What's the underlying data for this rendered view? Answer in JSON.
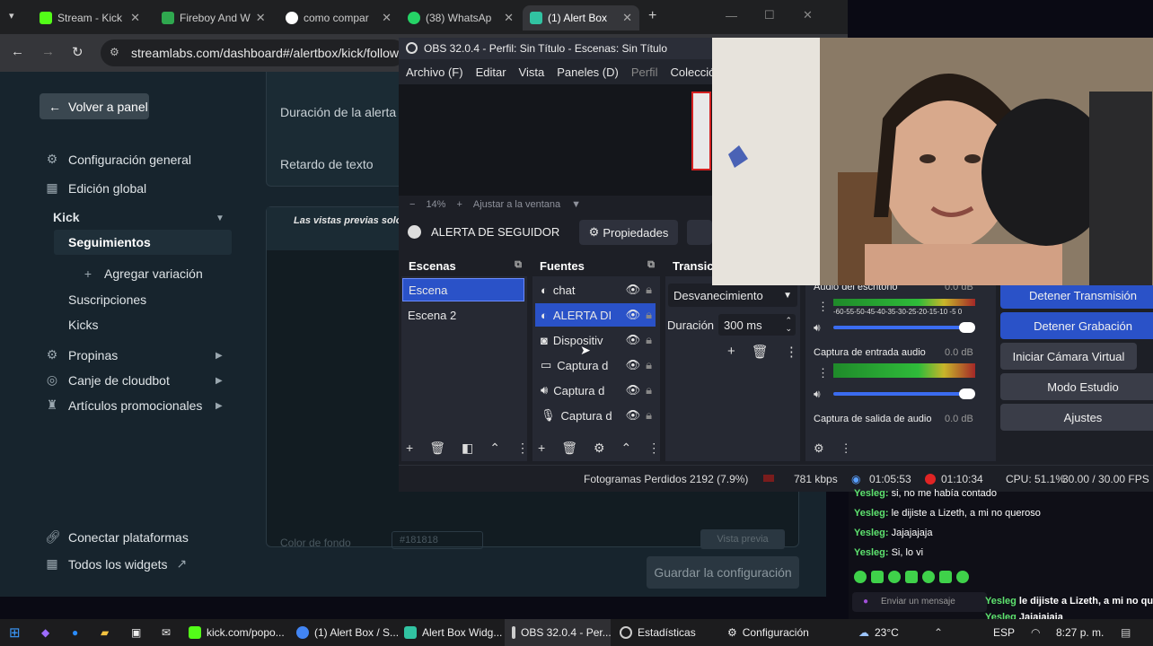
{
  "browser": {
    "tabs": [
      {
        "label": "Stream - Kick",
        "icon": "kick-icon",
        "color": "#53fc18"
      },
      {
        "label": "Fireboy And W",
        "icon": "game-icon",
        "color": "#2fa84f"
      },
      {
        "label": "como compar",
        "icon": "google-icon",
        "color": "#4285f4"
      },
      {
        "label": "(38) WhatsAp",
        "icon": "whatsapp-icon",
        "color": "#25d366"
      },
      {
        "label": "(1) Alert Box",
        "icon": "streamlabs-icon",
        "color": "#31c3a2"
      }
    ],
    "url": "streamlabs.com/dashboard#/alertbox/kick/follows"
  },
  "streamlabs": {
    "back_label": "Volver a panel",
    "nav": [
      {
        "label": "Configuración general",
        "icon": "gear-icon"
      },
      {
        "label": "Edición global",
        "icon": "grid-icon"
      }
    ],
    "kick_label": "Kick",
    "kick_items": [
      "Seguimientos",
      "Agregar variación",
      "Suscripciones",
      "Kicks"
    ],
    "more_nav": [
      {
        "label": "Propinas",
        "icon": "gear-icon"
      },
      {
        "label": "Canje de cloudbot",
        "icon": "cloudbot-icon"
      },
      {
        "label": "Artículos promocionales",
        "icon": "merch-icon"
      }
    ],
    "bottom_nav": [
      {
        "label": "Conectar plataformas",
        "icon": "link-icon"
      },
      {
        "label": "Todos los widgets",
        "icon": "widgets-icon"
      }
    ],
    "fields": {
      "duration": "Duración de la alerta",
      "text_delay": "Retardo de texto"
    },
    "preview_note": "Las vistas previas solo s",
    "bg_label": "Color de fondo",
    "bg_value": "#181818",
    "preview_button": "Vista previa",
    "save_label": "Guardar la configuración"
  },
  "obs": {
    "title": "OBS 32.0.4 - Perfil: Sin Título - Escenas: Sin Título",
    "menu": [
      "Archivo (F)",
      "Editar",
      "Vista",
      "Paneles (D)",
      "Perfil",
      "Colección"
    ],
    "zoom": "14%",
    "fit_label": "Ajustar a la ventana",
    "selected_source": "ALERTA DE SEGUIDOR",
    "properties_label": "Propiedades",
    "scenes_header": "Escenas",
    "scenes": [
      "Escena",
      "Escena 2"
    ],
    "sources_header": "Fuentes",
    "sources": [
      {
        "label": "chat",
        "icon": "browser-icon"
      },
      {
        "label": "ALERTA DI",
        "icon": "browser-icon"
      },
      {
        "label": "Dispositiv",
        "icon": "camera-icon"
      },
      {
        "label": "Captura d",
        "icon": "monitor-icon"
      },
      {
        "label": "Captura d",
        "icon": "speaker-icon"
      },
      {
        "label": "Captura d",
        "icon": "mic-icon"
      }
    ],
    "transitions_header": "Transici",
    "transition": "Desvanecimiento",
    "duration_label": "Duración",
    "duration_value": "300 ms",
    "mixer": [
      {
        "label": "Audio del escritorio",
        "db": "0.0 dB"
      },
      {
        "label": "Captura de entrada audio",
        "db": "0.0 dB"
      },
      {
        "label": "Captura de salida de audio",
        "db": "0.0 dB"
      }
    ],
    "meter_scale": "-60-55-50-45-40-35-30-25-20-15-10 -5 0",
    "controls": [
      "Detener Transmisión",
      "Detener Grabación",
      "Iniciar Cámara Virtual",
      "Modo Estudio",
      "Ajustes"
    ],
    "status": {
      "dropped": "Fotogramas Perdidos 2192 (7.9%)",
      "kbps": "781 kbps",
      "stream_time": "01:05:53",
      "rec_time": "01:10:34",
      "cpu": "CPU: 51.1%",
      "fps": "30.00 / 30.00 FPS"
    }
  },
  "chat": {
    "messages": [
      {
        "user": "Yesleg:",
        "text": "si, no me había contado"
      },
      {
        "user": "Yesleg:",
        "text": "le dijiste a Lizeth, a mi no queroso"
      },
      {
        "user": "Yesleg:",
        "text": "Jajajajaja"
      },
      {
        "user": "Yesleg:",
        "text": "Si, lo vi"
      }
    ],
    "input_placeholder": "Enviar un mensaje",
    "overlay": [
      {
        "user": "Yesleg",
        "text": "le dijiste a Lizeth, a mi no queroso"
      },
      {
        "user": "Yesleg",
        "text": "Jajajajaja"
      },
      {
        "user": "Yesleg",
        "text": "Si, lo vi"
      }
    ]
  },
  "taskbar": {
    "apps": [
      {
        "label": "kick.com/popo...",
        "color": "#53fc18"
      },
      {
        "label": "(1) Alert Box / S...",
        "color": "#4285f4"
      },
      {
        "label": "Alert Box Widg...",
        "color": "#31c3a2"
      },
      {
        "label": "OBS 32.0.4 - Per...",
        "color": "#cccccc"
      },
      {
        "label": "Estadísticas",
        "color": "#cccccc"
      },
      {
        "label": "Configuración",
        "color": "#cccccc"
      }
    ],
    "weather": "23°C",
    "lang": "ESP",
    "time": "8:27 p. m."
  }
}
